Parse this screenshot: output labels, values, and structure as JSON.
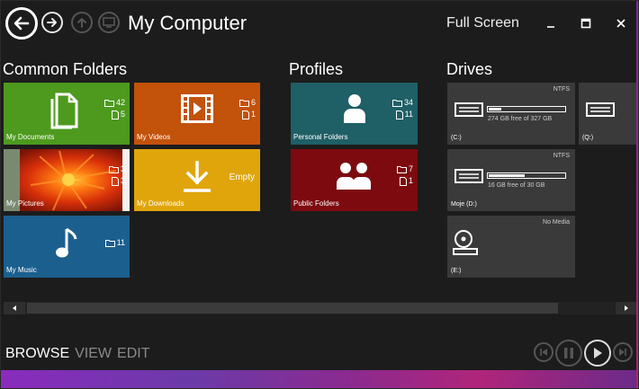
{
  "window": {
    "title": "My Computer",
    "full_screen_label": "Full Screen",
    "minimize_glyph": "_",
    "maximize_glyph": "☐",
    "close_glyph": "✕"
  },
  "sections": {
    "common": "Common Folders",
    "profiles": "Profiles",
    "drives": "Drives"
  },
  "folders": {
    "documents": {
      "label": "My Documents",
      "folders": "42",
      "files": "5"
    },
    "videos": {
      "label": "My Videos",
      "folders": "6",
      "files": "1"
    },
    "pictures": {
      "label": "My Pictures",
      "folders": "3",
      "files": "3"
    },
    "downloads": {
      "label": "My Downloads",
      "status": "Empty"
    },
    "music": {
      "label": "My Music",
      "folders": "11"
    }
  },
  "profiles": {
    "personal": {
      "label": "Personal Folders",
      "folders": "34",
      "files": "11"
    },
    "public": {
      "label": "Public Folders",
      "folders": "7",
      "files": "1"
    }
  },
  "drives": {
    "c": {
      "label": "(C:)",
      "fs": "NTFS",
      "free_text": "274 GB free of 327 GB",
      "used_fraction": 0.16
    },
    "q": {
      "label": "(Q:)"
    },
    "d": {
      "label": "Moje (D:)",
      "fs": "NTFS",
      "free_text": "16 GB free of 30 GB",
      "used_fraction": 0.47
    },
    "e": {
      "label": "(E:)",
      "status": "No Media"
    }
  },
  "bottom_nav": {
    "browse": "BROWSE",
    "view": "VIEW",
    "edit": "EDIT"
  },
  "colors": {
    "documents": "#4d9a1e",
    "videos": "#c3520a",
    "downloads": "#dfa50b",
    "music": "#1b5f8e",
    "personal": "#1f5f66",
    "public": "#7d0a0f",
    "drive": "#3a3a3a"
  }
}
